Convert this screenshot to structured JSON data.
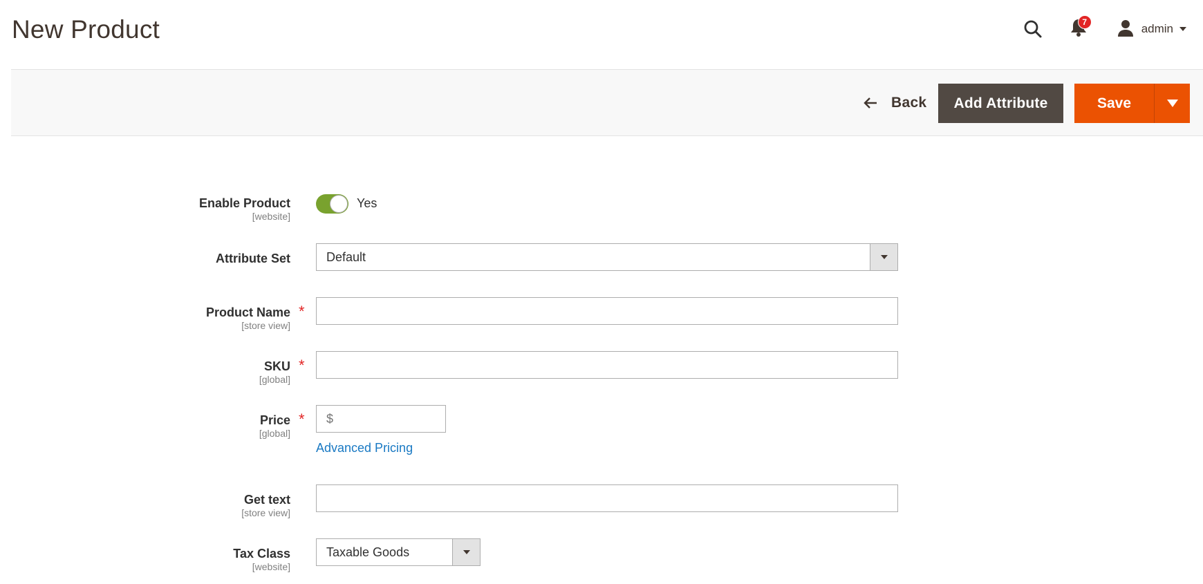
{
  "header": {
    "title": "New Product",
    "search_icon": "search-icon",
    "notifications": {
      "icon": "bell-icon",
      "count": "7"
    },
    "user": {
      "icon": "user-icon",
      "name": "admin"
    }
  },
  "action_bar": {
    "back_label": "Back",
    "add_attribute_label": "Add Attribute",
    "save_label": "Save"
  },
  "colors": {
    "primary": "#eb5202",
    "secondary": "#514943",
    "toggle_on": "#79a22e",
    "link": "#1979c3",
    "required": "#e22626"
  },
  "form": {
    "enable_product": {
      "label": "Enable Product",
      "scope": "[website]",
      "value": "Yes",
      "checked": true
    },
    "attribute_set": {
      "label": "Attribute Set",
      "value": "Default"
    },
    "product_name": {
      "label": "Product Name",
      "scope": "[store view]",
      "required": "*",
      "value": ""
    },
    "sku": {
      "label": "SKU",
      "scope": "[global]",
      "required": "*",
      "value": ""
    },
    "price": {
      "label": "Price",
      "scope": "[global]",
      "required": "*",
      "placeholder": "$",
      "value": "",
      "advanced_link": "Advanced Pricing"
    },
    "get_text": {
      "label": "Get text",
      "scope": "[store view]",
      "value": ""
    },
    "tax_class": {
      "label": "Tax Class",
      "scope": "[website]",
      "value": "Taxable Goods"
    }
  }
}
